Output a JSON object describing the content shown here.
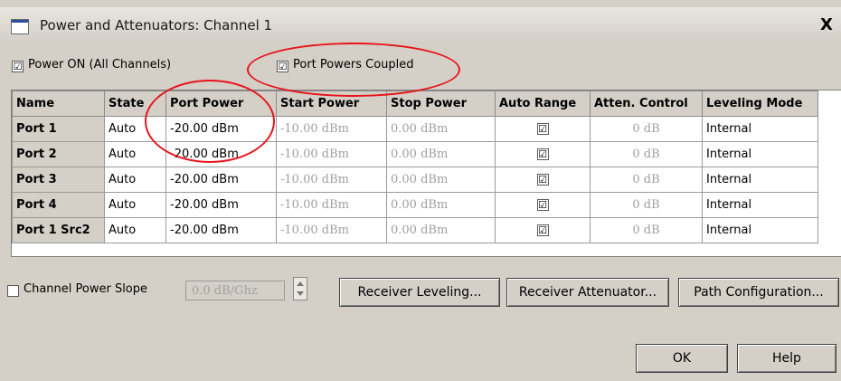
{
  "window": {
    "title": "Power and Attenuators: Channel 1",
    "close_glyph": "X"
  },
  "power_on": {
    "label": "Power ON (All Channels)",
    "checked": true,
    "check_glyph": "☑"
  },
  "port_powers_coupled": {
    "label": "Port Powers Coupled",
    "checked": true,
    "check_glyph": "☑"
  },
  "grid": {
    "headers": [
      "Name",
      "State",
      "Port Power",
      "Start Power",
      "Stop Power",
      "Auto Range",
      "Atten. Control",
      "Leveling Mode"
    ],
    "rows": [
      {
        "name": "Port 1",
        "state": "Auto",
        "port_power": "-20.00 dBm",
        "start_power": "-10.00 dBm",
        "stop_power": "0.00 dBm",
        "auto_range": "☑",
        "atten": "0 dB",
        "leveling": "Internal"
      },
      {
        "name": "Port 2",
        "state": "Auto",
        "port_power": "-20.00 dBm",
        "start_power": "-10.00 dBm",
        "stop_power": "0.00 dBm",
        "auto_range": "☑",
        "atten": "0 dB",
        "leveling": "Internal"
      },
      {
        "name": "Port 3",
        "state": "Auto",
        "port_power": "-20.00 dBm",
        "start_power": "-10.00 dBm",
        "stop_power": "0.00 dBm",
        "auto_range": "☑",
        "atten": "0 dB",
        "leveling": "Internal"
      },
      {
        "name": "Port 4",
        "state": "Auto",
        "port_power": "-20.00 dBm",
        "start_power": "-10.00 dBm",
        "stop_power": "0.00 dBm",
        "auto_range": "☑",
        "atten": "0 dB",
        "leveling": "Internal"
      },
      {
        "name": "Port 1 Src2",
        "state": "Auto",
        "port_power": "-20.00 dBm",
        "start_power": "-10.00 dBm",
        "stop_power": "0.00 dBm",
        "auto_range": "☑",
        "atten": "0 dB",
        "leveling": "Internal"
      }
    ]
  },
  "channel_power_slope": {
    "label": "Channel Power Slope",
    "checked": false,
    "value": "0.0 dB/Ghz"
  },
  "buttons": {
    "receiver_leveling": "Receiver Leveling...",
    "receiver_attenuator": "Receiver Attenuator...",
    "path_configuration": "Path Configuration...",
    "ok": "OK",
    "help": "Help"
  },
  "colors": {
    "annotation": "#e8141c",
    "dialog_bg": "#d4d0c8",
    "disabled_text": "#a0a0a0"
  }
}
